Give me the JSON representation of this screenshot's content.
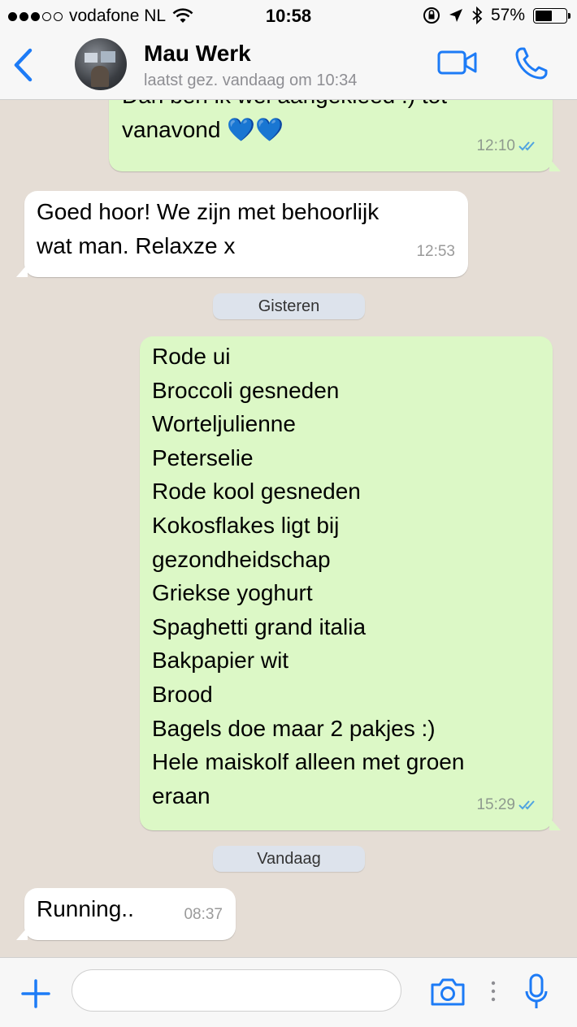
{
  "status_bar": {
    "carrier": "vodafone NL",
    "time": "10:58",
    "battery": "57%",
    "battery_level": 0.57,
    "signal_bars_filled": 3,
    "signal_bars_total": 5
  },
  "header": {
    "contact_name": "Mau Werk",
    "contact_status": "laatst gez. vandaag om 10:34",
    "accent_color": "#1d7bf6"
  },
  "messages": [
    {
      "direction": "out",
      "text": "Dan ben ik wel aangekleed :) tot\nvanavond 💙💙",
      "time": "12:10",
      "read": true
    },
    {
      "direction": "in",
      "text": "Goed hoor! We zijn met behoorlijk\nwat man. Relaxze x",
      "time": "12:53"
    },
    {
      "direction": "out",
      "text": "Rode ui\nBroccoli gesneden\nWorteljulienne\nPeterselie\nRode kool gesneden\nKokosflakes ligt bij\ngezondheidschap\nGriekse yoghurt\nSpaghetti grand italia\nBakpapier wit\nBrood\nBagels doe maar 2 pakjes :)\nHele maiskolf alleen met groen\neraan",
      "time": "15:29",
      "read": true
    },
    {
      "direction": "in",
      "text": "Running..",
      "time": "08:37"
    }
  ],
  "day_separators": [
    "Gisteren",
    "Vandaag"
  ],
  "colors": {
    "outgoing_bubble": "#dcf8c6",
    "incoming_bubble": "#ffffff",
    "chat_background": "#e5ddd5",
    "read_ticks": "#4fa3e0"
  },
  "icons": {
    "back": "chevron-left-icon",
    "video": "video-camera-icon",
    "call": "phone-icon",
    "attach": "plus-icon",
    "camera": "camera-icon",
    "mic": "microphone-icon"
  }
}
